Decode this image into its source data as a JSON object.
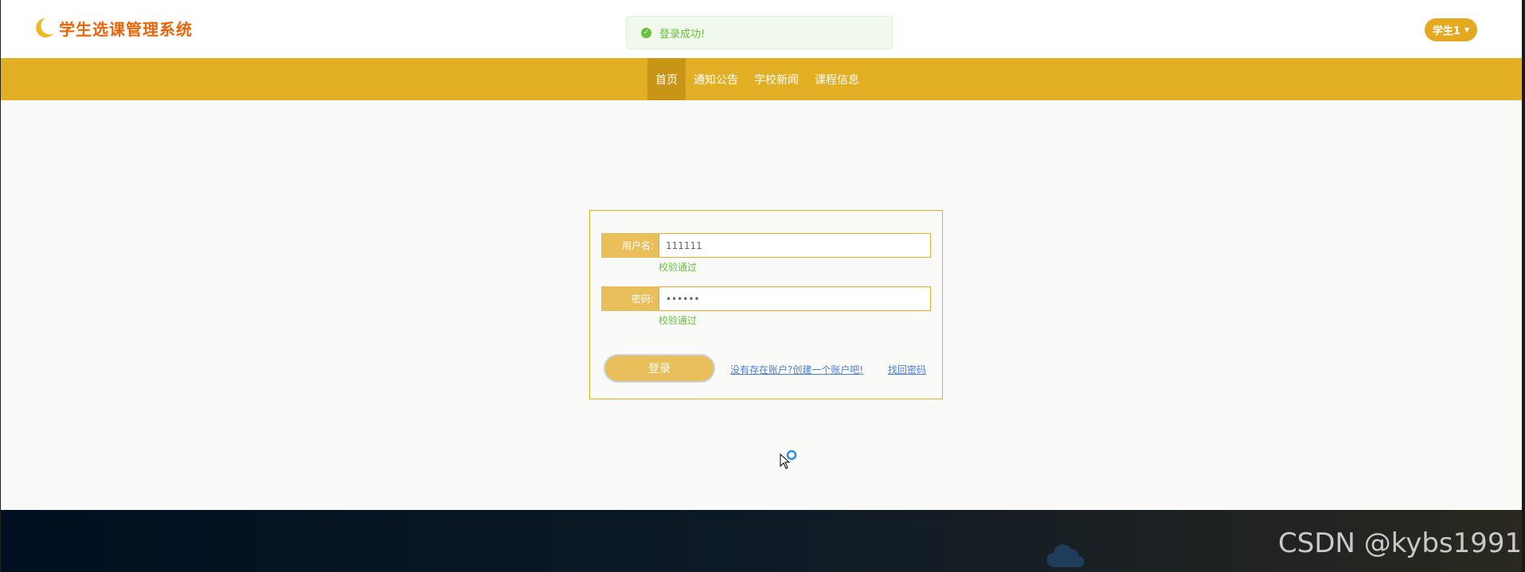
{
  "header": {
    "logo_icon": "moon-icon",
    "app_title": "学生选课管理系统",
    "toast": {
      "icon": "check-circle-icon",
      "message": "登录成功!"
    },
    "user_menu": {
      "label": "学生1",
      "icon": "caret-down-icon"
    }
  },
  "nav": {
    "items": [
      {
        "label": "首页",
        "active": true
      },
      {
        "label": "通知公告",
        "active": false
      },
      {
        "label": "学校新闻",
        "active": false
      },
      {
        "label": "课程信息",
        "active": false
      }
    ]
  },
  "login_form": {
    "username": {
      "label": "用户名:",
      "value": "111111",
      "validation": "校验通过"
    },
    "password": {
      "label": "密码:",
      "value": "••••••",
      "validation": "校验通过"
    },
    "login_button": "登录",
    "register_link": "没有存在账户?创建一个账户吧!",
    "forgot_link": "找回密码"
  },
  "footer": {
    "watermark": "CSDN @kybs1991",
    "cloud_icon": "cloud-icon"
  },
  "colors": {
    "accent": "#e2ae23",
    "nav_active": "#c99517",
    "label_bg": "#e8bf5a",
    "success": "#67c23a",
    "logo_text": "#e8650a",
    "link": "#4a7fd6"
  }
}
